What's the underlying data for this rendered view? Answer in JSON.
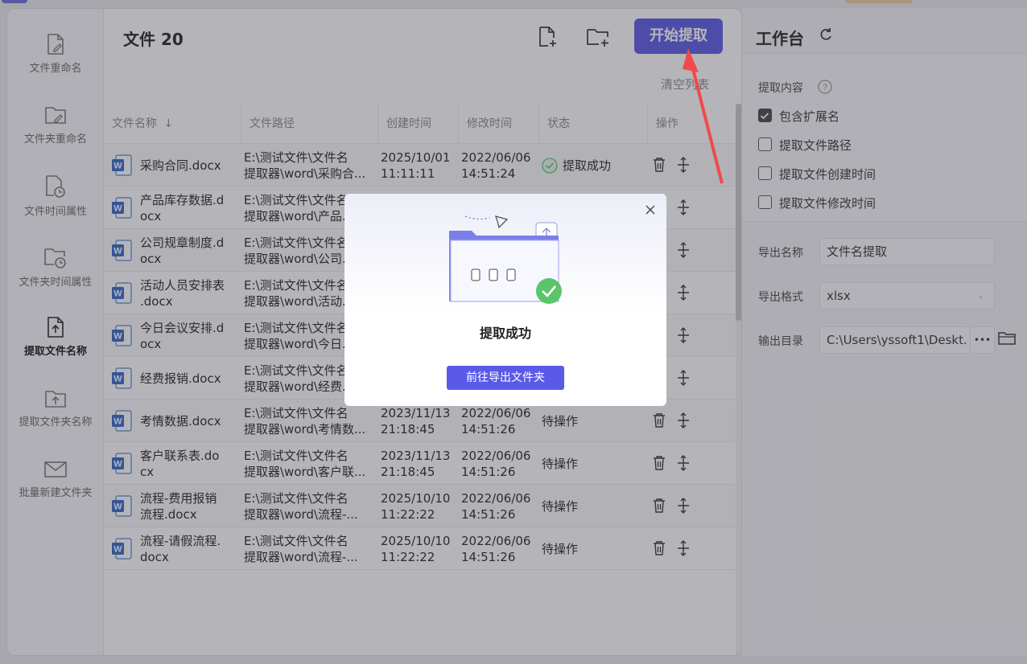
{
  "header": {
    "file_count_title": "文件 20",
    "start_button": "开始提取",
    "clear_list": "清空列表"
  },
  "sidebar": {
    "items": [
      {
        "label": "文件重命名",
        "icon": "file-edit-icon"
      },
      {
        "label": "文件夹重命名",
        "icon": "folder-edit-icon"
      },
      {
        "label": "文件时间属性",
        "icon": "file-clock-icon"
      },
      {
        "label": "文件夹时间属性",
        "icon": "folder-clock-icon"
      },
      {
        "label": "提取文件名称",
        "icon": "file-upload-icon",
        "active": true
      },
      {
        "label": "提取文件夹名称",
        "icon": "folder-upload-icon"
      },
      {
        "label": "批量新建文件夹",
        "icon": "mail-folder-icon"
      }
    ]
  },
  "table": {
    "columns": [
      "文件名称",
      "文件路径",
      "创建时间",
      "修改时间",
      "状态",
      "操作"
    ],
    "rows": [
      {
        "name": "采购合同.docx",
        "path": "E:\\测试文件\\文件名\n提取器\\word\\采购合...",
        "created": "2025/10/01\n11:11:11",
        "modified": "2022/06/06\n14:51:24",
        "status": "提取成功",
        "ok": true
      },
      {
        "name": "产品库存数据.d\nocx",
        "path": "E:\\测试文件\\文件名\n提取器\\word\\产品...",
        "created": "",
        "modified": "",
        "status": "",
        "ok": false
      },
      {
        "name": "公司规章制度.d\nocx",
        "path": "E:\\测试文件\\文件名\n提取器\\word\\公司...",
        "created": "",
        "modified": "",
        "status": "",
        "ok": false
      },
      {
        "name": "活动人员安排表\n.docx",
        "path": "E:\\测试文件\\文件名\n提取器\\word\\活动...",
        "created": "",
        "modified": "",
        "status": "",
        "ok": false
      },
      {
        "name": "今日会议安排.d\nocx",
        "path": "E:\\测试文件\\文件名\n提取器\\word\\今日...",
        "created": "",
        "modified": "",
        "status": "",
        "ok": false
      },
      {
        "name": "经费报销.docx",
        "path": "E:\\测试文件\\文件名\n提取器\\word\\经费...",
        "created": "",
        "modified": "",
        "status": "",
        "ok": false
      },
      {
        "name": "考情数据.docx",
        "path": "E:\\测试文件\\文件名\n提取器\\word\\考情数...",
        "created": "2023/11/13\n21:18:45",
        "modified": "2022/06/06\n14:51:26",
        "status": "待操作",
        "ok": false
      },
      {
        "name": "客户联系表.do\ncx",
        "path": "E:\\测试文件\\文件名\n提取器\\word\\客户联...",
        "created": "2023/11/13\n21:18:45",
        "modified": "2022/06/06\n14:51:26",
        "status": "待操作",
        "ok": false
      },
      {
        "name": "流程-费用报销\n流程.docx",
        "path": "E:\\测试文件\\文件名\n提取器\\word\\流程-...",
        "created": "2025/10/10\n11:22:22",
        "modified": "2022/06/06\n14:51:26",
        "status": "待操作",
        "ok": false
      },
      {
        "name": "流程-请假流程.\ndocx",
        "path": "E:\\测试文件\\文件名\n提取器\\word\\流程-...",
        "created": "2025/10/10\n11:22:22",
        "modified": "2022/06/06\n14:51:26",
        "status": "待操作",
        "ok": false
      }
    ]
  },
  "workbench": {
    "title": "工作台",
    "extract_content_label": "提取内容",
    "options": [
      {
        "label": "包含扩展名",
        "checked": true
      },
      {
        "label": "提取文件路径",
        "checked": false
      },
      {
        "label": "提取文件创建时间",
        "checked": false
      },
      {
        "label": "提取文件修改时间",
        "checked": false
      }
    ],
    "export_name_label": "导出名称",
    "export_name_value": "文件名提取",
    "export_format_label": "导出格式",
    "export_format_value": "xlsx",
    "output_dir_label": "输出目录",
    "output_dir_value": "C:\\Users\\yssoft1\\Deskt.",
    "more_dots": "•••"
  },
  "modal": {
    "title": "提取成功",
    "button": "前往导出文件夹"
  },
  "colors": {
    "accent": "#5858e6",
    "success": "#5cc46a"
  }
}
